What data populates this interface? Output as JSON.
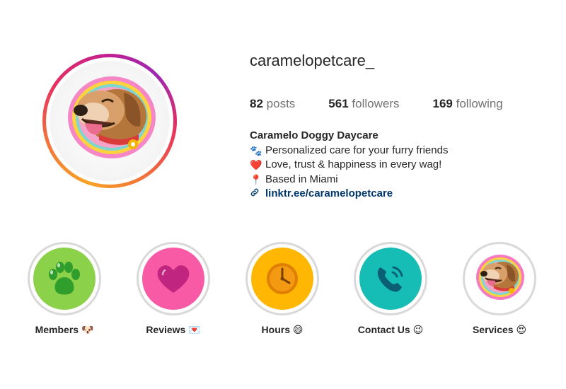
{
  "profile": {
    "username": "caramelopetcare_",
    "stats": {
      "posts": {
        "count": "82",
        "label": "posts"
      },
      "followers": {
        "count": "561",
        "label": "followers"
      },
      "following": {
        "count": "169",
        "label": "following"
      }
    },
    "bio": {
      "name": "Caramelo Doggy Daycare",
      "lines": [
        {
          "icon": "paw-prints-icon",
          "emoji": "🐾",
          "text": "Personalized care for your furry friends"
        },
        {
          "icon": "red-heart-icon",
          "emoji": "❤️",
          "text": "Love, trust & happiness in every wag!"
        },
        {
          "icon": "pin-icon",
          "emoji": "📍",
          "text": "Based in Miami"
        }
      ],
      "link": {
        "icon": "link-icon",
        "text": "linktr.ee/caramelopetcare"
      }
    }
  },
  "highlights": [
    {
      "label": "Members 🐶",
      "icon": "paw-icon",
      "color": "#8bd14a"
    },
    {
      "label": "Reviews 💌",
      "icon": "heart-icon",
      "color": "#f85aa6"
    },
    {
      "label": "Hours 😄",
      "icon": "clock-icon",
      "color": "#ffb703"
    },
    {
      "label": "Contact Us 😉",
      "icon": "phone-icon",
      "color": "#16bdb4"
    },
    {
      "label": "Services 😍",
      "icon": "dog-avatar-icon",
      "color": "#ffffff"
    }
  ],
  "colors": {
    "text": "#262626",
    "muted": "#737373",
    "link": "#00376b",
    "ring_gray": "#d9d9d9"
  }
}
